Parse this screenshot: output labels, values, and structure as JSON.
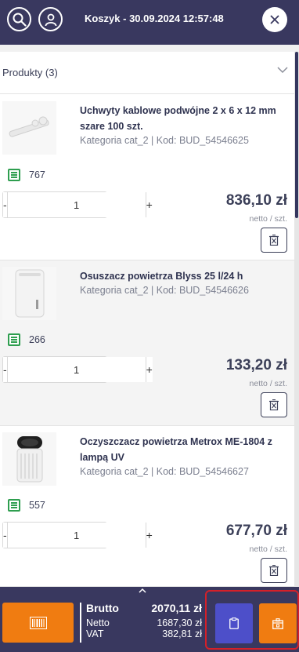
{
  "header": {
    "title": "Koszyk - 30.09.2024 12:57:48",
    "search_icon": "search-icon",
    "user_icon": "user-icon",
    "close_icon": "close-icon"
  },
  "section": {
    "title": "Produkty (3)"
  },
  "products": [
    {
      "name": "Uchwyty kablowe podwójne 2 x 6 x 12 mm szare 100 szt.",
      "meta": "Kategoria cat_2 | Kod: BUD_54546625",
      "stock": "767",
      "qty": "1",
      "price": "836,10 zł",
      "unit": "netto / szt."
    },
    {
      "name": "Osuszacz powietrza Blyss 25 l/24 h",
      "meta": "Kategoria cat_2 | Kod: BUD_54546626",
      "stock": "266",
      "qty": "1",
      "price": "133,20 zł",
      "unit": "netto / szt."
    },
    {
      "name": "Oczyszczacz powietrza Metrox ME-1804 z lampą UV",
      "meta": "Kategoria cat_2 | Kod: BUD_54546627",
      "stock": "557",
      "qty": "1",
      "price": "677,70 zł",
      "unit": "netto / szt."
    }
  ],
  "qty_controls": {
    "minus": "-",
    "plus": "+"
  },
  "totals": {
    "brutto_label": "Brutto",
    "brutto_value": "2070,11 zł",
    "netto_label": "Netto",
    "netto_value": "1687,30 zł",
    "vat_label": "VAT",
    "vat_value": "382,81 zł"
  },
  "colors": {
    "header_bg": "#39385f",
    "orange": "#f07c11",
    "purple": "#4d4fc9",
    "stock_green": "#2e9e4f",
    "highlight_red": "#d42029"
  }
}
